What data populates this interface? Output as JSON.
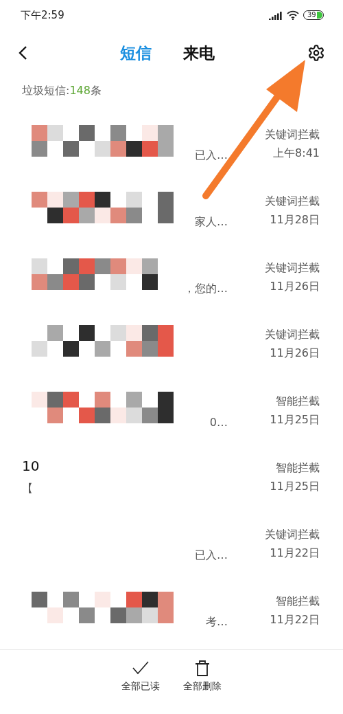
{
  "status_bar": {
    "time": "下午2:59",
    "battery": "39"
  },
  "header": {
    "tabs": [
      {
        "label": "短信",
        "selected": true
      },
      {
        "label": "来电",
        "selected": false
      }
    ]
  },
  "summary": {
    "label": "垃圾短信:",
    "count": "148",
    "unit": "条"
  },
  "messages": [
    {
      "mosaic": true,
      "preview": "已入…",
      "filter": "关键词拦截",
      "time": "上午8:41"
    },
    {
      "mosaic": true,
      "preview": "家人…",
      "filter": "关键词拦截",
      "time": "11月28日"
    },
    {
      "mosaic": true,
      "preview": "，您的…",
      "filter": "关键词拦截",
      "time": "11月26日"
    },
    {
      "mosaic": true,
      "filter": "关键词拦截",
      "time": "11月26日"
    },
    {
      "mosaic": true,
      "preview": "0…",
      "filter": "智能拦截",
      "time": "11月25日"
    },
    {
      "mosaic": false,
      "sender": "10",
      "preview_start": "【",
      "filter": "智能拦截",
      "time": "11月25日"
    },
    {
      "mosaic": false,
      "preview": "已入…",
      "filter": "关键词拦截",
      "time": "11月22日"
    },
    {
      "mosaic": true,
      "preview": "考…",
      "filter": "智能拦截",
      "time": "11月22日"
    }
  ],
  "actions": [
    {
      "kind": "check",
      "label": "全部已读"
    },
    {
      "kind": "trash",
      "label": "全部删除"
    }
  ]
}
